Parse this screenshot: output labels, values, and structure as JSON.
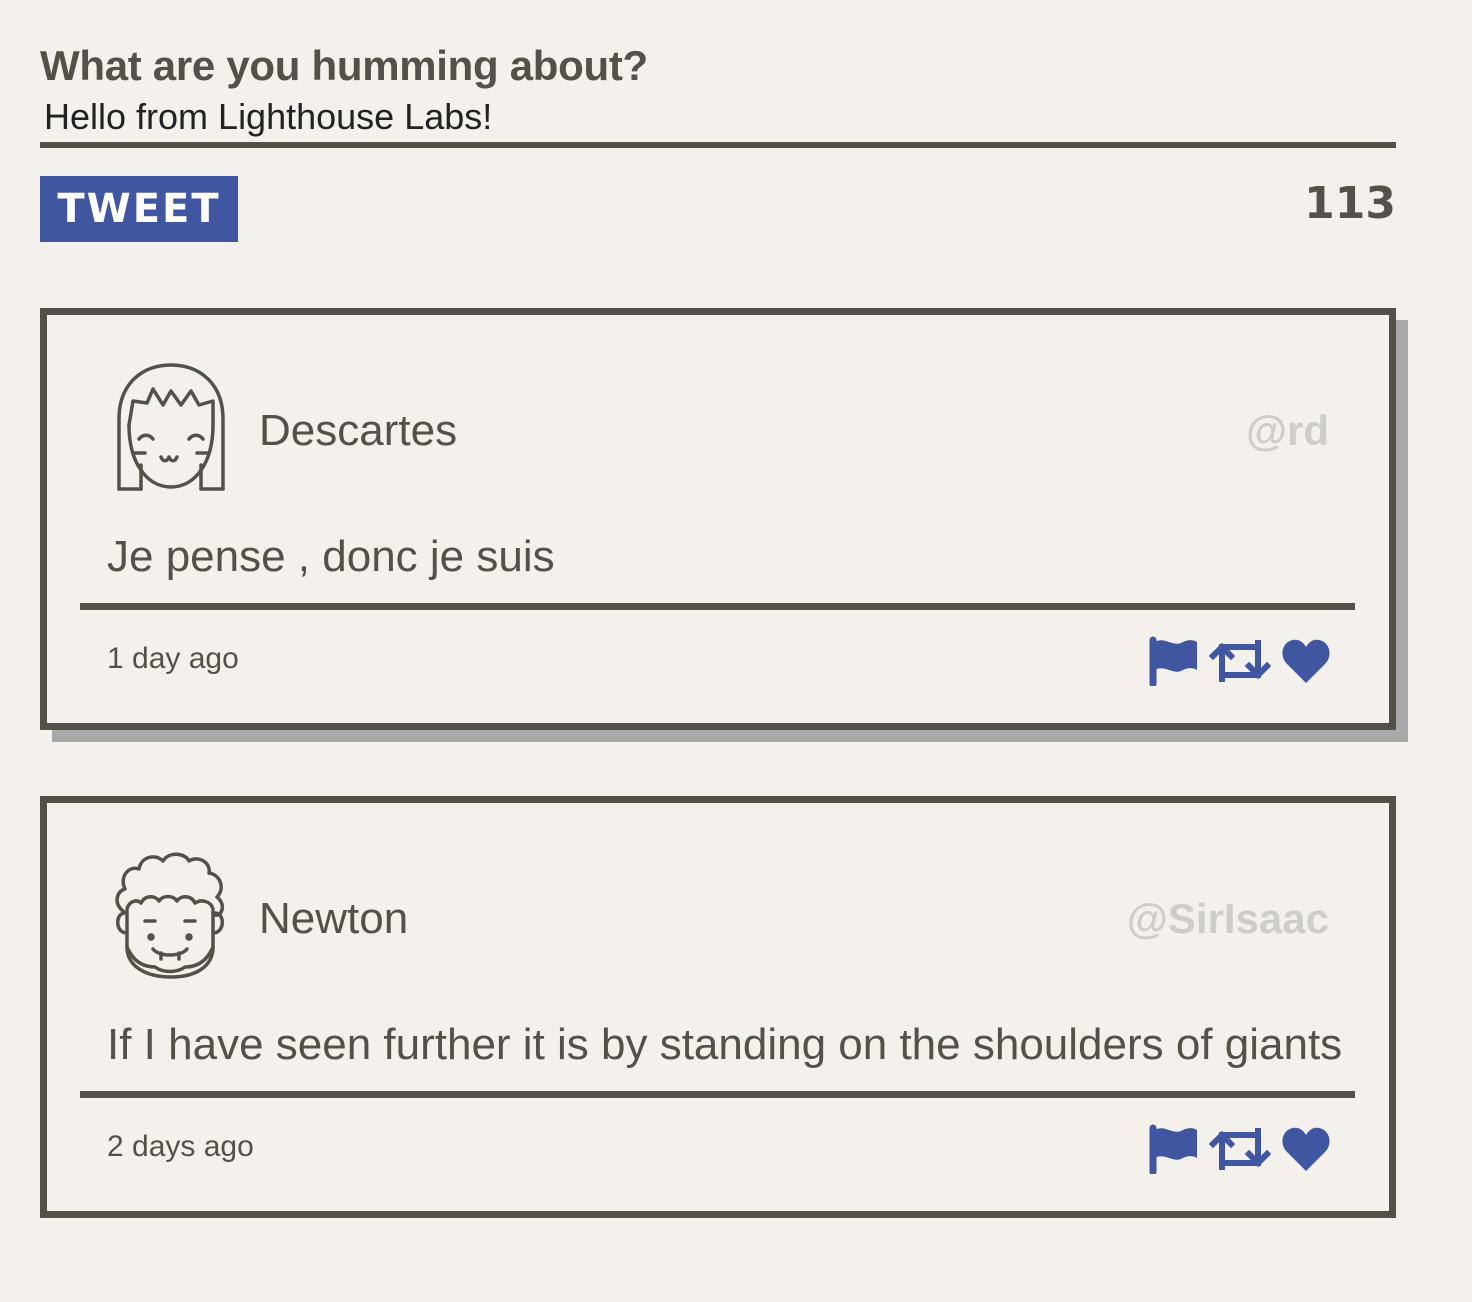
{
  "compose": {
    "heading": "What are you humming about?",
    "input_value": "Hello from Lighthouse Labs!",
    "button_label": "TWEET",
    "char_counter": "113"
  },
  "colors": {
    "accent": "#4056a1",
    "text": "#545149",
    "handle": "#cfcdca",
    "background": "#f4f1ec",
    "shadow": "#a9a9a9"
  },
  "tweets": [
    {
      "name": "Descartes",
      "handle": "@rd",
      "avatar_icon": "girl-avatar-icon",
      "content": "Je pense , donc je suis",
      "time": "1 day ago",
      "actions": [
        "flag-icon",
        "retweet-icon",
        "heart-icon"
      ]
    },
    {
      "name": "Newton",
      "handle": "@SirIsaac",
      "avatar_icon": "curly-hair-avatar-icon",
      "content": "If I have seen further it is by standing on the shoulders of giants",
      "time": "2 days ago",
      "actions": [
        "flag-icon",
        "retweet-icon",
        "heart-icon"
      ]
    }
  ]
}
